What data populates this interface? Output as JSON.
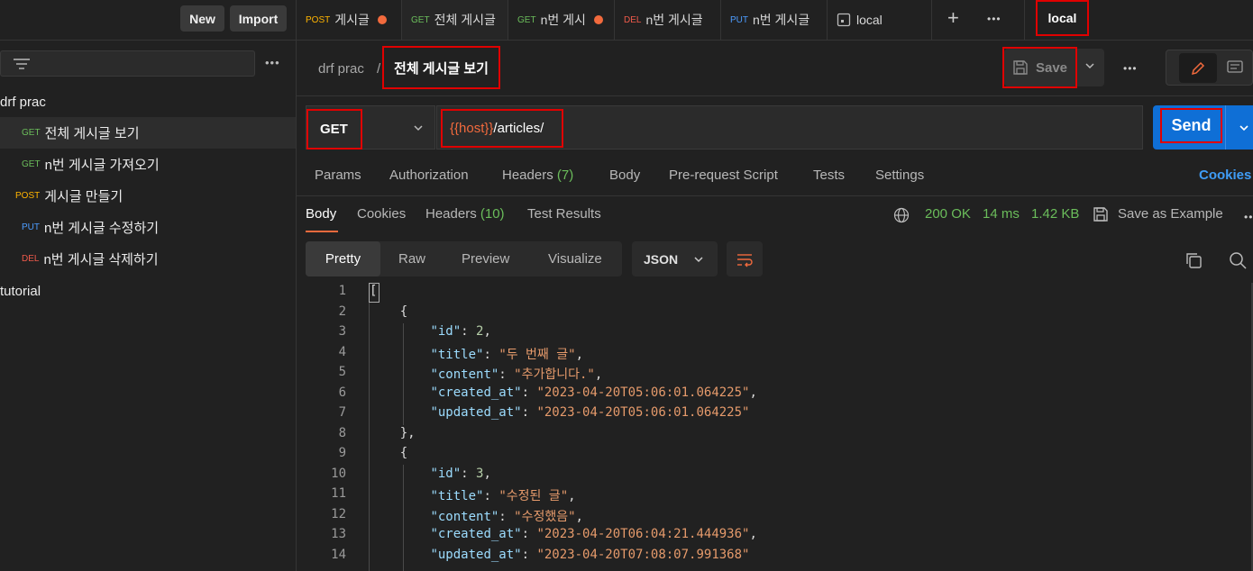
{
  "sidebar": {
    "new_label": "New",
    "import_label": "Import",
    "more_label": "•••",
    "collections": [
      {
        "name": "drf prac"
      },
      {
        "name": "tutorial"
      }
    ],
    "requests": [
      {
        "method": "GET",
        "label": "전체 게시글 보기"
      },
      {
        "method": "GET",
        "label": "n번 게시글 가져오기"
      },
      {
        "method": "POST",
        "label": "게시글 만들기"
      },
      {
        "method": "PUT",
        "label": "n번 게시글 수정하기"
      },
      {
        "method": "DEL",
        "label": "n번 게시글 삭제하기"
      }
    ]
  },
  "tabs": [
    {
      "method": "POST",
      "label": "게시글"
    },
    {
      "method": "GET",
      "label": "전체 게시글"
    },
    {
      "method": "GET",
      "label": "n번 게시"
    },
    {
      "method": "DEL",
      "label": "n번 게시글"
    },
    {
      "method": "PUT",
      "label": "n번 게시글"
    }
  ],
  "environment_tab": "local",
  "tab_more": "•••",
  "environment_selector": "local",
  "breadcrumb": {
    "collection": "drf prac",
    "separator": "/",
    "request": "전체 게시글 보기"
  },
  "toolbar": {
    "save_label": "Save",
    "more": "•••"
  },
  "request": {
    "method": "GET",
    "url_var": "{{host}}",
    "url_path": "/articles/",
    "send_label": "Send"
  },
  "request_tabs": {
    "params": "Params",
    "authorization": "Authorization",
    "headers": "Headers",
    "headers_count": "(7)",
    "body": "Body",
    "prerequest": "Pre-request Script",
    "tests": "Tests",
    "settings": "Settings",
    "cookies": "Cookies"
  },
  "response_tabs": {
    "body": "Body",
    "cookies": "Cookies",
    "headers": "Headers",
    "headers_count": "(10)",
    "test_results": "Test Results"
  },
  "response_status": {
    "status": "200 OK",
    "time": "14 ms",
    "size": "1.42 KB",
    "save_example": "Save as Example",
    "more": "•••"
  },
  "view_modes": {
    "pretty": "Pretty",
    "raw": "Raw",
    "preview": "Preview",
    "visualize": "Visualize",
    "format": "JSON"
  },
  "colors": {
    "get": "#6bbd5b",
    "post": "#ffb400",
    "put": "#4d9dff",
    "del": "#f05a4b",
    "send": "#0f6fd6",
    "accent": "#f26a3d",
    "highlight_box": "#e00000"
  },
  "code_lines": [
    {
      "n": "1",
      "indent": "",
      "parts": [
        {
          "c": "p",
          "t": "["
        }
      ]
    },
    {
      "n": "2",
      "indent": "    ",
      "parts": [
        {
          "c": "p",
          "t": "{"
        }
      ]
    },
    {
      "n": "3",
      "indent": "        ",
      "parts": [
        {
          "c": "k",
          "t": "\"id\""
        },
        {
          "c": "p",
          "t": ": "
        },
        {
          "c": "n",
          "t": "2"
        },
        {
          "c": "p",
          "t": ","
        }
      ]
    },
    {
      "n": "4",
      "indent": "        ",
      "parts": [
        {
          "c": "k",
          "t": "\"title\""
        },
        {
          "c": "p",
          "t": ": "
        },
        {
          "c": "s",
          "t": "\"두 번째 글\""
        },
        {
          "c": "p",
          "t": ","
        }
      ]
    },
    {
      "n": "5",
      "indent": "        ",
      "parts": [
        {
          "c": "k",
          "t": "\"content\""
        },
        {
          "c": "p",
          "t": ": "
        },
        {
          "c": "s",
          "t": "\"추가합니다.\""
        },
        {
          "c": "p",
          "t": ","
        }
      ]
    },
    {
      "n": "6",
      "indent": "        ",
      "parts": [
        {
          "c": "k",
          "t": "\"created_at\""
        },
        {
          "c": "p",
          "t": ": "
        },
        {
          "c": "s",
          "t": "\"2023-04-20T05:06:01.064225\""
        },
        {
          "c": "p",
          "t": ","
        }
      ]
    },
    {
      "n": "7",
      "indent": "        ",
      "parts": [
        {
          "c": "k",
          "t": "\"updated_at\""
        },
        {
          "c": "p",
          "t": ": "
        },
        {
          "c": "s",
          "t": "\"2023-04-20T05:06:01.064225\""
        }
      ]
    },
    {
      "n": "8",
      "indent": "    ",
      "parts": [
        {
          "c": "p",
          "t": "},"
        }
      ]
    },
    {
      "n": "9",
      "indent": "    ",
      "parts": [
        {
          "c": "p",
          "t": "{"
        }
      ]
    },
    {
      "n": "10",
      "indent": "        ",
      "parts": [
        {
          "c": "k",
          "t": "\"id\""
        },
        {
          "c": "p",
          "t": ": "
        },
        {
          "c": "n",
          "t": "3"
        },
        {
          "c": "p",
          "t": ","
        }
      ]
    },
    {
      "n": "11",
      "indent": "        ",
      "parts": [
        {
          "c": "k",
          "t": "\"title\""
        },
        {
          "c": "p",
          "t": ": "
        },
        {
          "c": "s",
          "t": "\"수정된 글\""
        },
        {
          "c": "p",
          "t": ","
        }
      ]
    },
    {
      "n": "12",
      "indent": "        ",
      "parts": [
        {
          "c": "k",
          "t": "\"content\""
        },
        {
          "c": "p",
          "t": ": "
        },
        {
          "c": "s",
          "t": "\"수정했음\""
        },
        {
          "c": "p",
          "t": ","
        }
      ]
    },
    {
      "n": "13",
      "indent": "        ",
      "parts": [
        {
          "c": "k",
          "t": "\"created_at\""
        },
        {
          "c": "p",
          "t": ": "
        },
        {
          "c": "s",
          "t": "\"2023-04-20T06:04:21.444936\""
        },
        {
          "c": "p",
          "t": ","
        }
      ]
    },
    {
      "n": "14",
      "indent": "        ",
      "parts": [
        {
          "c": "k",
          "t": "\"updated_at\""
        },
        {
          "c": "p",
          "t": ": "
        },
        {
          "c": "s",
          "t": "\"2023-04-20T07:08:07.991368\""
        }
      ]
    }
  ]
}
